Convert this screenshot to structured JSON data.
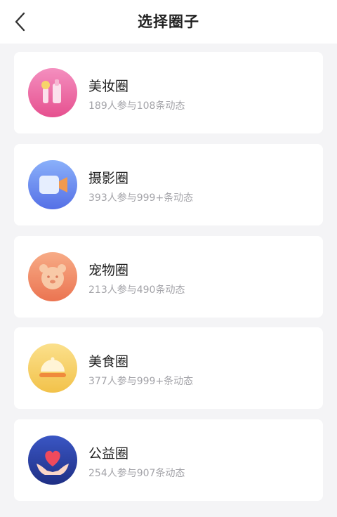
{
  "header": {
    "title": "选择圈子"
  },
  "circles": [
    {
      "name": "美妆圈",
      "stats": "189人参与108条动态",
      "icon": "cosmetics-icon",
      "color": "#ec6fa6"
    },
    {
      "name": "摄影圈",
      "stats": "393人参与999+条动态",
      "icon": "video-camera-icon",
      "color": "#6a8bf2"
    },
    {
      "name": "宠物圈",
      "stats": "213人参与490条动态",
      "icon": "bear-face-icon",
      "color": "#ef8a60"
    },
    {
      "name": "美食圈",
      "stats": "377人参与999+条动态",
      "icon": "food-dome-icon",
      "color": "#f5cf5e"
    },
    {
      "name": "公益圈",
      "stats": "254人参与907条动态",
      "icon": "hands-heart-icon",
      "color": "#2b3fa0"
    }
  ]
}
